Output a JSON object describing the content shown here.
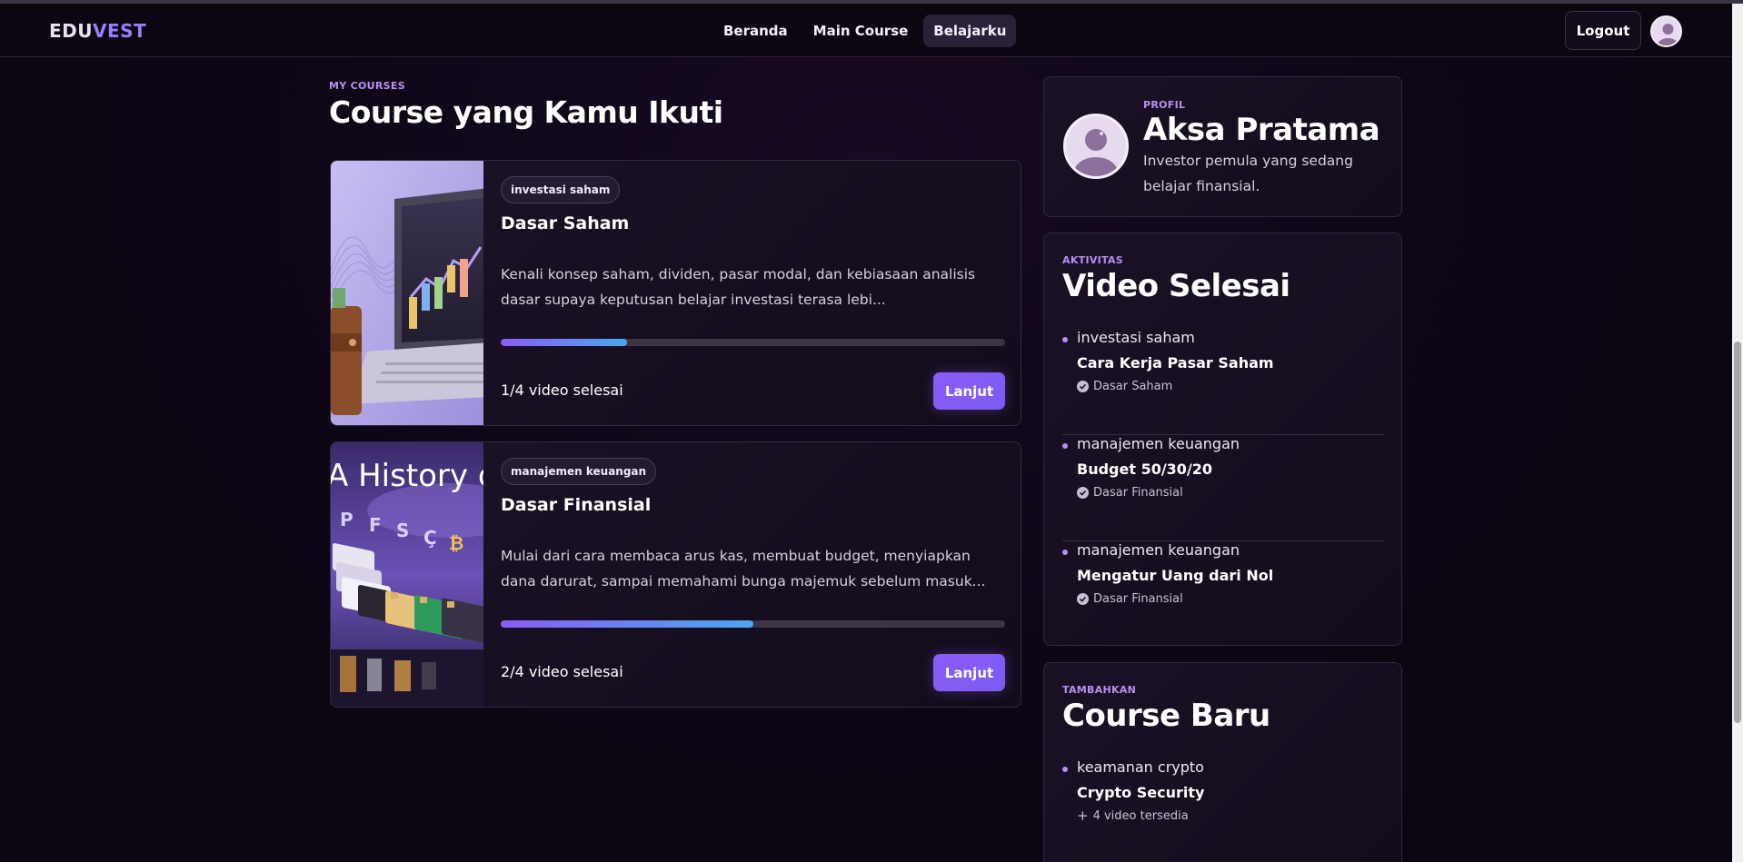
{
  "navbar": {
    "logo_part1": "EDU",
    "logo_part2": "VEST",
    "links": [
      {
        "label": "Beranda"
      },
      {
        "label": "Main Course"
      },
      {
        "label": "Belajarku"
      }
    ],
    "logout_label": "Logout",
    "accent_color": "#8b5cf6"
  },
  "main": {
    "eyebrow": "MY COURSES",
    "title": "Course yang Kamu Ikuti",
    "courses": [
      {
        "tag": "investasi saham",
        "title": "Dasar Saham",
        "desc_line1": "Kenali konsep saham, dividen, pasar modal, dan kebiasaan analisis",
        "desc_line2": "dasar supaya keputusan belajar investasi terasa lebi...",
        "progress": 0.25,
        "count": "1/4 video selesai",
        "button": "Lanjut"
      },
      {
        "tag": "manajemen keuangan",
        "title": "Dasar Finansial",
        "desc_line1": "Mulai dari cara membaca arus kas, membuat budget, menyiapkan",
        "desc_line2": "dana darurat, sampai memahami bunga majemuk sebelum masuk...",
        "progress": 0.5,
        "count": "2/4 video selesai",
        "button": "Lanjut",
        "thumb_text": "A History of"
      }
    ]
  },
  "profile": {
    "eyebrow": "PROFIL",
    "name": "Aksa Pratama",
    "bio": "Investor pemula yang sedang belajar finansial."
  },
  "activity": {
    "eyebrow": "AKTIVITAS",
    "title": "Video Selesai",
    "items": [
      {
        "category": "investasi saham",
        "title": "Cara Kerja Pasar Saham",
        "course": "Dasar Saham"
      },
      {
        "category": "manajemen keuangan",
        "title": "Budget 50/30/20",
        "course": "Dasar Finansial"
      },
      {
        "category": "manajemen keuangan",
        "title": "Mengatur Uang dari Nol",
        "course": "Dasar Finansial"
      }
    ]
  },
  "new_course": {
    "eyebrow": "TAMBAHKAN",
    "title": "Course Baru",
    "items": [
      {
        "category": "keamanan crypto",
        "title": "Crypto Security",
        "meta": "4 video tersedia"
      }
    ]
  }
}
